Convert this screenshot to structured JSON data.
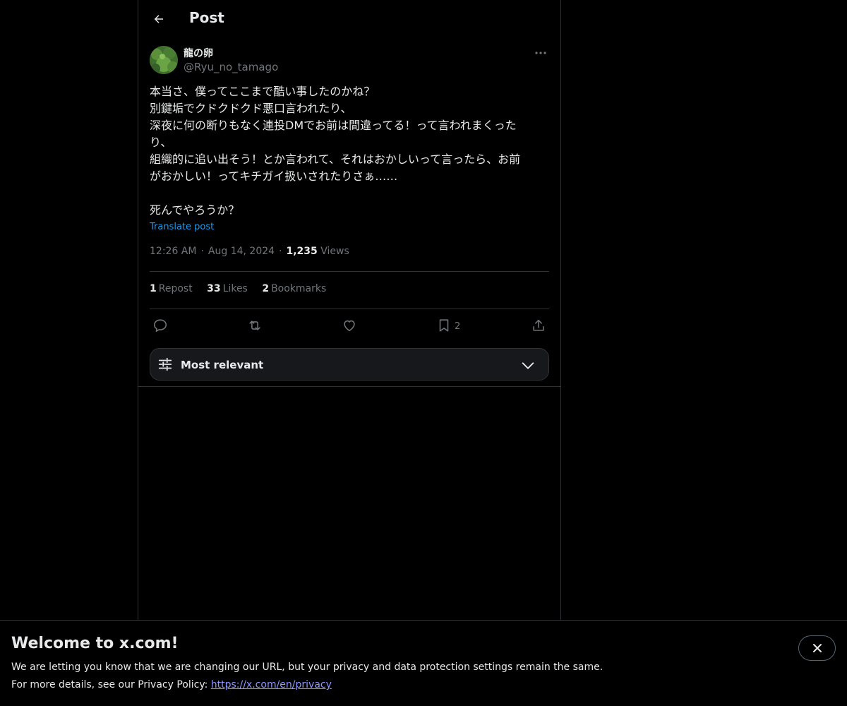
{
  "header": {
    "title": "Post"
  },
  "author": {
    "display_name": "龍の卵",
    "handle": "@Ryu_no_tamago"
  },
  "post": {
    "lines": [
      "本当さ、僕ってここまで酷い事したのかね？",
      "別鍵垢でクドクドクド悪口言われたり、",
      "深夜に何の断りもなく連投DMでお前は間違ってる！って言われまくった",
      "り、",
      "組織的に追い出そう！とか言われて、それはおかしいって言ったら、お前",
      "がおかしい！ってキチガイ扱いされたりさぁ……",
      "",
      "死んでやろうか？"
    ],
    "translate_label": "Translate post",
    "time": "12:26 AM",
    "date": "Aug 14, 2024",
    "views_count": "1,235",
    "views_label": "Views",
    "separator": "·"
  },
  "stats": {
    "reposts_count": "1",
    "reposts_label": "Repost",
    "likes_count": "33",
    "likes_label": "Likes",
    "bookmarks_count": "2",
    "bookmarks_label": "Bookmarks"
  },
  "actions": {
    "bookmark_count": "2"
  },
  "sort": {
    "label": "Most relevant"
  },
  "banner": {
    "title": "Welcome to x.com!",
    "line1": "We are letting you know that we are changing our URL, but your privacy and data protection settings remain the same.",
    "line2_prefix": "For more details, see our Privacy Policy: ",
    "link": "https://x.com/en/privacy"
  },
  "colors": {
    "background": "#000000",
    "text": "#e7e9ea",
    "muted": "#71767b",
    "accent": "#1d9bf0",
    "border": "#2f3336"
  },
  "icons": [
    "back-arrow-icon",
    "more-dots-icon",
    "reply-icon",
    "repost-icon",
    "like-icon",
    "bookmark-icon",
    "share-icon",
    "filter-sliders-icon",
    "chevron-down-icon",
    "close-icon"
  ]
}
